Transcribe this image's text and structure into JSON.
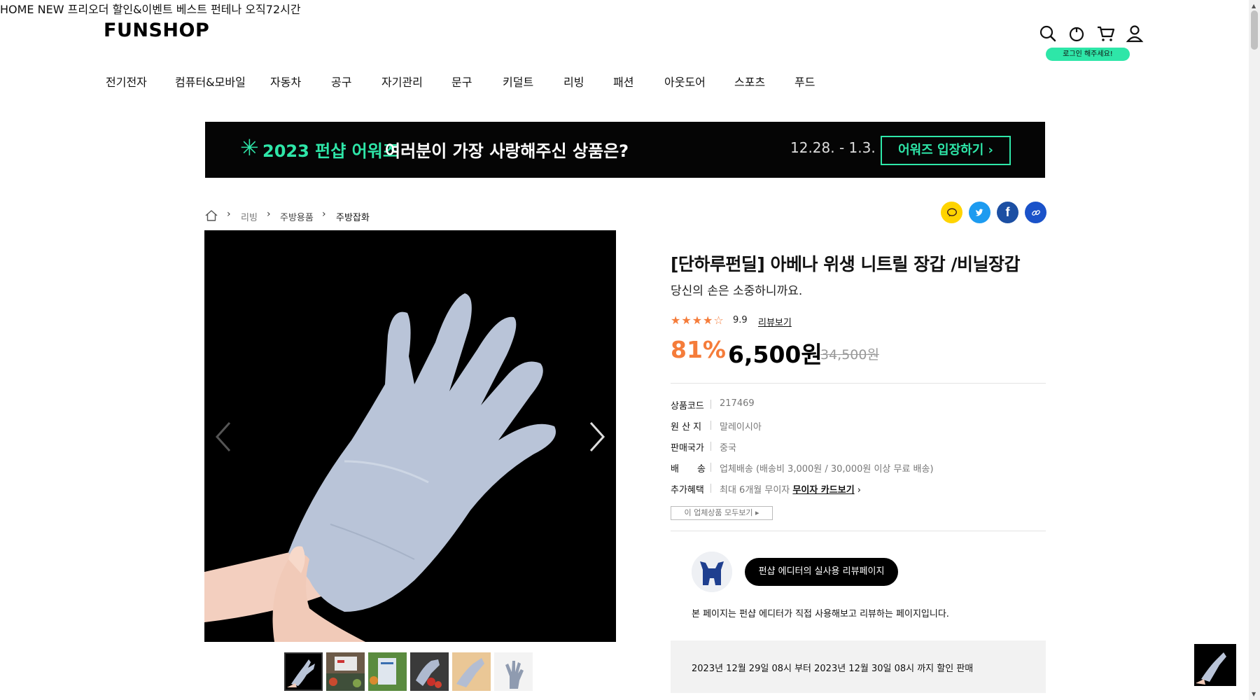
{
  "header": {
    "logo": "FUNSHOP",
    "main_nav": [
      "HOME",
      "NEW",
      "프리오더",
      "할인&이벤트",
      "베스트",
      "펀테나",
      "오직72시간"
    ],
    "icons": [
      "search-icon",
      "timer-icon",
      "cart-icon",
      "user-icon"
    ],
    "login_tip": "로그인 해주세요!",
    "categories": [
      "전기전자",
      "컴퓨터&모바일",
      "자동차",
      "공구",
      "자기관리",
      "문구",
      "키덜트",
      "리빙",
      "패션",
      "아웃도어",
      "스포츠",
      "푸드"
    ]
  },
  "banner": {
    "star": "✳",
    "green_text": "2023 펀샵 어워즈",
    "white_text": "여러분이 가장 사랑해주신 상품은?",
    "date": "12.28. - 1.3.",
    "button": "어워즈 입장하기"
  },
  "breadcrumb": {
    "sep": "›",
    "items": [
      "리빙",
      "주방용품",
      "주방잡화"
    ]
  },
  "share": {
    "icons": [
      "kakaotalk-icon",
      "twitter-icon",
      "facebook-icon",
      "link-icon"
    ],
    "colors": [
      "#ffd400",
      "#1d9bf0",
      "#1c4fa3",
      "#1a52c9"
    ]
  },
  "product": {
    "title": "[단하루펀딜] 아베나 위생 니트릴 장갑 /비닐장갑",
    "subtitle": "당신의 손은 소중하니까요.",
    "rating_stars": "★★★★☆",
    "rating_value": 4.5,
    "rating": "9.9",
    "review_link": "리뷰보기",
    "discount": "81%",
    "price": "6,500원",
    "original_price": "34,500원",
    "accent_color": "#f57c3a",
    "specs": [
      {
        "key": "상품코드",
        "value": "217469"
      },
      {
        "key": "원 산 지",
        "value": "말레이시아"
      },
      {
        "key": "판매국가",
        "value": "중국"
      },
      {
        "key": "배　　송",
        "value": "업체배송 (배송비 3,000원 / 30,000원 이상 무료 배송)"
      },
      {
        "key": "추가혜택",
        "value": "최대 6개월 무이자",
        "link": "무이자 카드보기"
      }
    ],
    "link_arrow": "›",
    "seller_button": "이 업체상품 모두보기 ▸",
    "editor_button": "펀샵 에디터의 실사용 리뷰페이지",
    "editor_note": "본 페이지는 펀샵 에디터가 직접 사용해보고 리뷰하는 페이지입니다.",
    "sale_period": "2023년 12월 29일 08시 부터 2023년 12월 30일 08시 까지 할인 판매"
  },
  "gallery": {
    "thumbnail_count": 6,
    "active_index": 0
  },
  "scrollbar": {
    "up": "▲",
    "down": "▼"
  }
}
